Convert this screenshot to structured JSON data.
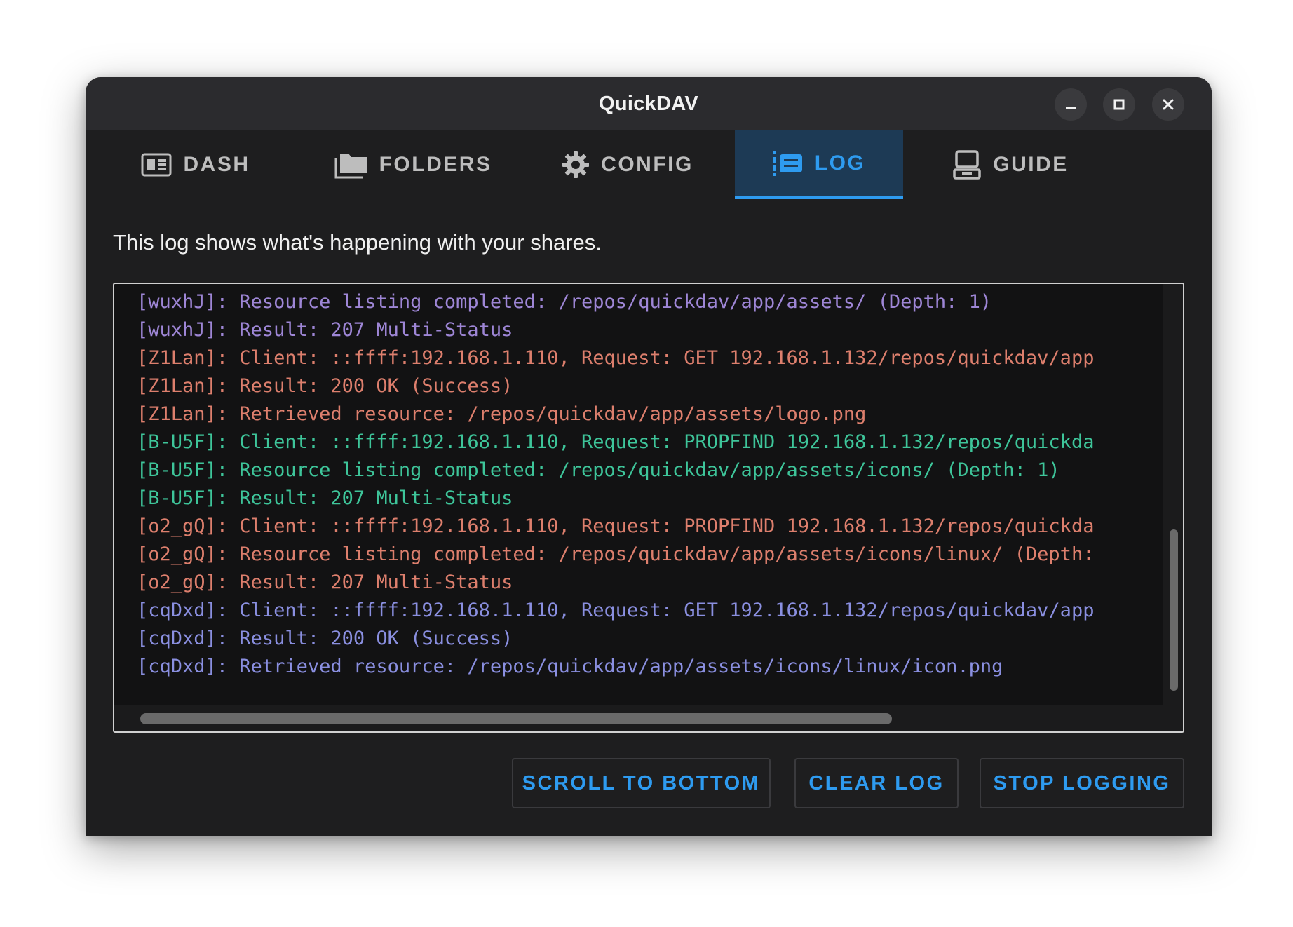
{
  "window": {
    "title": "QuickDAV"
  },
  "tabs": [
    {
      "label": "DASH",
      "icon": "dashboard-icon",
      "active": false
    },
    {
      "label": "FOLDERS",
      "icon": "folders-icon",
      "active": false
    },
    {
      "label": "CONFIG",
      "icon": "gear-icon",
      "active": false
    },
    {
      "label": "LOG",
      "icon": "log-list-icon",
      "active": true
    },
    {
      "label": "GUIDE",
      "icon": "computer-icon",
      "active": false
    }
  ],
  "log": {
    "description": "This log shows what's happening with your shares.",
    "lines": [
      {
        "text": "[wuxhJ]: Resource listing completed: /repos/quickdav/app/assets/ (Depth: 1)",
        "color": "purple"
      },
      {
        "text": "[wuxhJ]: Result: 207 Multi-Status",
        "color": "purple"
      },
      {
        "text": "[Z1Lan]: Client: ::ffff:192.168.1.110, Request: GET 192.168.1.132/repos/quickdav/app",
        "color": "salmon"
      },
      {
        "text": "[Z1Lan]: Result: 200 OK (Success)",
        "color": "salmon"
      },
      {
        "text": "[Z1Lan]: Retrieved resource: /repos/quickdav/app/assets/logo.png",
        "color": "salmon"
      },
      {
        "text": "[B-U5F]: Client: ::ffff:192.168.1.110, Request: PROPFIND 192.168.1.132/repos/quickda",
        "color": "green"
      },
      {
        "text": "[B-U5F]: Resource listing completed: /repos/quickdav/app/assets/icons/ (Depth: 1)",
        "color": "green"
      },
      {
        "text": "[B-U5F]: Result: 207 Multi-Status",
        "color": "green"
      },
      {
        "text": "[o2_gQ]: Client: ::ffff:192.168.1.110, Request: PROPFIND 192.168.1.132/repos/quickda",
        "color": "salmon"
      },
      {
        "text": "[o2_gQ]: Resource listing completed: /repos/quickdav/app/assets/icons/linux/ (Depth:",
        "color": "salmon"
      },
      {
        "text": "[o2_gQ]: Result: 207 Multi-Status",
        "color": "salmon"
      },
      {
        "text": "[cqDxd]: Client: ::ffff:192.168.1.110, Request: GET 192.168.1.132/repos/quickdav/app",
        "color": "blue"
      },
      {
        "text": "[cqDxd]: Result: 200 OK (Success)",
        "color": "blue"
      },
      {
        "text": "[cqDxd]: Retrieved resource: /repos/quickdav/app/assets/icons/linux/icon.png",
        "color": "blue"
      }
    ]
  },
  "actions": {
    "scroll_to_bottom": "SCROLL TO BOTTOM",
    "clear_log": "CLEAR LOG",
    "stop_logging": "STOP LOGGING"
  },
  "colors": {
    "accent": "#2e9bf0",
    "active_tab_bg": "#1d3a55",
    "log_purple": "#9e86d6",
    "log_salmon": "#dd7f6d",
    "log_green": "#3ec59a",
    "log_blue": "#8a8fe0"
  }
}
